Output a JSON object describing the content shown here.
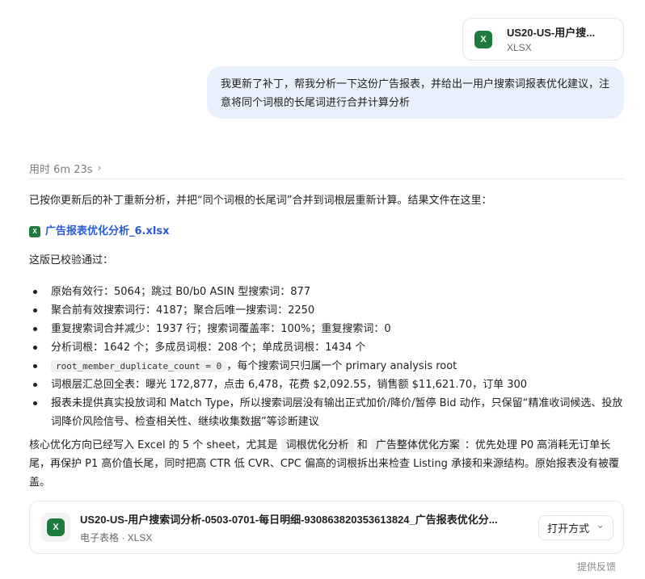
{
  "top_file": {
    "name": "US20-US-用户搜...",
    "type": "XLSX",
    "icon": "excel-icon"
  },
  "user_message": "我更新了补丁，帮我分析一下这份广告报表，并给出一用户搜索词报表优化建议，注意将同个词根的长尾词进行合并计算分析",
  "timing": {
    "label": "用时 6m 23s",
    "chevron": "›"
  },
  "answer": {
    "intro": "已按你更新后的补丁重新分析，并把“同个词根的长尾词”合并到词根层重新计算。结果文件在这里：",
    "file_link": "广告报表优化分析_6.xlsx",
    "verified": "这版已校验通过：",
    "bullets": [
      "原始有效行：5064；跳过 B0/b0 ASIN 型搜索词：877",
      "聚合前有效搜索词行：4187；聚合后唯一搜索词：2250",
      "重复搜索词合并减少：1937 行；搜索词覆盖率：100%；重复搜索词：0",
      "分析词根：1642 个；多成员词根：208 个；单成员词根：1434 个",
      "词根层汇总回全表：曝光 172,877，点击 6,478，花费 $2,092.55，销售额 $11,621.70，订单 300",
      "报表未提供真实投放词和 Match Type，所以搜索词层没有输出正式加价/降价/暂停 Bid 动作，只保留“精准收词候选、投放词降价风险信号、检查相关性、继续收集数据”等诊断建议"
    ],
    "bullet5_code": "root_member_duplicate_count = 0",
    "bullet5_text": "，每个搜索词只归属一个 primary analysis root",
    "summary_pre": "核心优化方向已经写入 Excel 的 5 个 sheet，尤其是 ",
    "summary_tag1": "词根优化分析",
    "summary_mid": " 和 ",
    "summary_tag2": "广告整体优化方案",
    "summary_post": "：优先处理 P0 高消耗无订单长尾，再保护 P1 高价值长尾，同时把高 CTR 低 CVR、CPC 偏高的词根拆出来检查 Listing 承接和来源结构。原始报表没有被覆盖。"
  },
  "bottom_file": {
    "name": "US20-US-用户搜索词分析-0503-0701-每日明细-930863820353613824_广告报表优化分...",
    "meta": "电子表格 · XLSX",
    "open_label": "打开方式",
    "open_chevron": "⌄",
    "icon": "excel-icon"
  },
  "feedback_label": "提供反馈",
  "colors": {
    "accent": "#2a5bd7",
    "excel": "#1f7a3d",
    "bubble": "#e8f1fb"
  }
}
